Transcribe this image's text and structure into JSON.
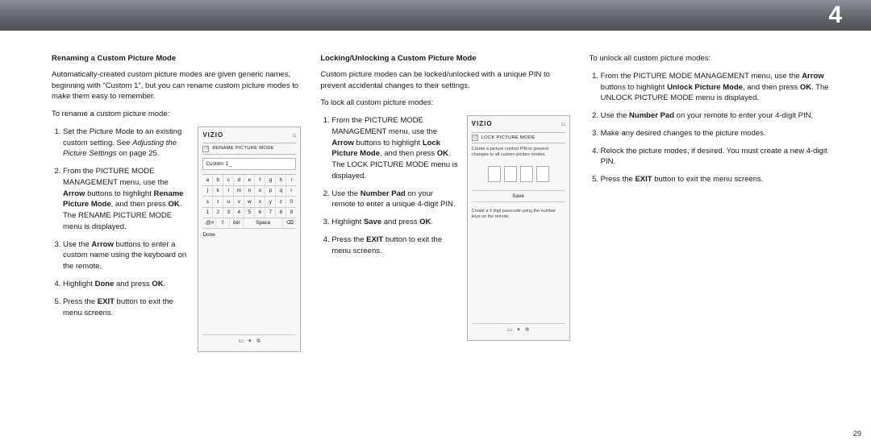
{
  "topbar": {
    "chapter": "4"
  },
  "page_number": "29",
  "col1": {
    "heading": "Renaming a Custom Picture Mode",
    "intro": "Automatically-created custom picture modes are given generic names, beginning with \"Custom 1\", but you can rename custom picture modes to make them easy to remember.",
    "lead": "To rename a custom picture mode:",
    "step1_a": "Set the Picture Mode to an existing custom setting. See ",
    "step1_i": "Adjusting the Picture Settings",
    "step1_b": " on page 25.",
    "step2_a": "From the PICTURE MODE MANAGEMENT menu, use the ",
    "step2_b1": "Arrow",
    "step2_c": " buttons to highlight ",
    "step2_b2": "Rename Picture Mode",
    "step2_d": ", and then press ",
    "step2_b3": "OK",
    "step2_e": ". The RENAME PICTURE MODE menu is displayed.",
    "step3_a": "Use the ",
    "step3_b": "Arrow",
    "step3_c": " buttons to enter a custom name using the keyboard on the remote.",
    "step4_a": "Highlight ",
    "step4_b1": "Done",
    "step4_c": " and press ",
    "step4_b2": "OK",
    "step4_d": ".",
    "step5_a": "Press the ",
    "step5_b": "EXIT",
    "step5_c": " button to exit the menu screens.",
    "screen": {
      "brand": "VIZIO",
      "title": "RENAME PICTURE MODE",
      "input": "Custom 1_",
      "rows": [
        [
          "a",
          "b",
          "c",
          "d",
          "e",
          "f",
          "g",
          "h",
          "i"
        ],
        [
          "j",
          "k",
          "l",
          "m",
          "n",
          "o",
          "p",
          "q",
          "r"
        ],
        [
          "s",
          "t",
          "u",
          "v",
          "w",
          "x",
          "y",
          "z",
          "0"
        ],
        [
          "1",
          "2",
          "3",
          "4",
          "5",
          "6",
          "7",
          "8",
          "9"
        ]
      ],
      "fn": {
        "shift": "⇧",
        "caps": ".@#",
        "sym": "ôèí",
        "space": "Space",
        "del": "⌫"
      },
      "done": "Done"
    }
  },
  "col2": {
    "heading": "Locking/Unlocking a Custom Picture Mode",
    "intro": "Custom picture modes can be locked/unlocked with a unique PIN to prevent accidental changes to their settings.",
    "lead": "To lock all custom picture modes:",
    "step1_a": "From the PICTURE MODE MANAGEMENT menu, use the ",
    "step1_b1": "Arrow",
    "step1_c": " buttons to highlight ",
    "step1_b2": "Lock Picture Mode",
    "step1_d": ", and then press ",
    "step1_b3": "OK",
    "step1_e": ". The LOCK PICTURE MODE menu is displayed.",
    "step2_a": "Use the ",
    "step2_b": "Number Pad",
    "step2_c": " on your remote to enter a unique 4-digit PIN.",
    "step3_a": "Highlight ",
    "step3_b1": "Save",
    "step3_c": " and press ",
    "step3_b2": "OK",
    "step3_d": ".",
    "step4_a": "Press the ",
    "step4_b": "EXIT",
    "step4_c": " button to exit the menu screens.",
    "screen": {
      "brand": "VIZIO",
      "title": "LOCK PICTURE MODE",
      "desc": "Create a picture control PIN to prevent changes to all custom picture modes.",
      "save": "Save",
      "footnote": "Create a 4 digit passcode using the number keys on the remote."
    }
  },
  "col3": {
    "lead": "To unlock all custom picture modes:",
    "step1_a": "From the PICTURE MODE MANAGEMENT menu, use the ",
    "step1_b1": "Arrow",
    "step1_c": " buttons to highlight ",
    "step1_b2": "Unlock Picture Mode",
    "step1_d": ", and then press ",
    "step1_b3": "OK",
    "step1_e": ". The UNLOCK PICTURE MODE menu is displayed.",
    "step2_a": "Use the ",
    "step2_b": "Number Pad",
    "step2_c": " on your remote to enter your 4-digit PIN.",
    "step3": "Make any desired changes to the picture modes.",
    "step4": "Relock the picture modes, if desired. You must create a new 4-digit PIN.",
    "step5_a": "Press the ",
    "step5_b": "EXIT",
    "step5_c": " button to exit the menu screens."
  }
}
